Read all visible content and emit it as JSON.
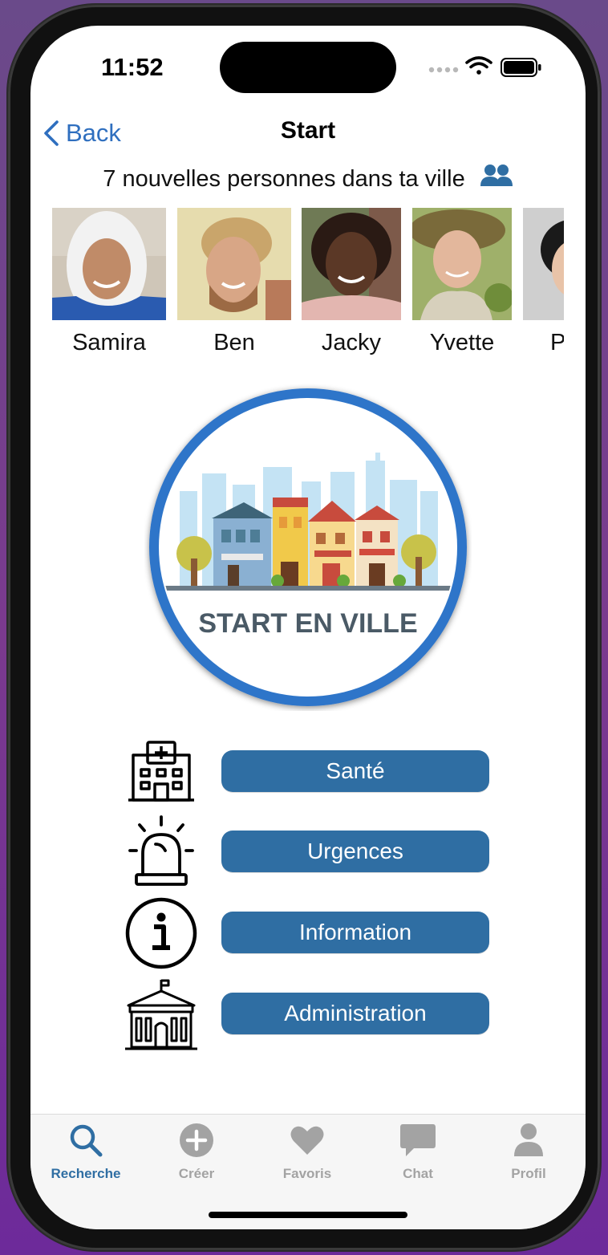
{
  "status": {
    "time": "11:52"
  },
  "nav": {
    "back_label": "Back",
    "title": "Start"
  },
  "headline": "7 nouvelles personnes dans ta ville",
  "people": [
    {
      "name": "Samira"
    },
    {
      "name": "Ben"
    },
    {
      "name": "Jacky"
    },
    {
      "name": "Yvette"
    },
    {
      "name": "P"
    }
  ],
  "logo": {
    "text": "START EN VILLE"
  },
  "actions": [
    {
      "label": "Santé",
      "icon": "hospital-icon"
    },
    {
      "label": "Urgences",
      "icon": "siren-icon"
    },
    {
      "label": "Information",
      "icon": "info-icon"
    },
    {
      "label": "Administration",
      "icon": "city-hall-icon"
    }
  ],
  "tabbar": {
    "items": [
      {
        "label": "Recherche",
        "icon": "search-icon",
        "active": true
      },
      {
        "label": "Créer",
        "icon": "plus-circle-icon",
        "active": false
      },
      {
        "label": "Favoris",
        "icon": "heart-icon",
        "active": false
      },
      {
        "label": "Chat",
        "icon": "chat-icon",
        "active": false
      },
      {
        "label": "Profil",
        "icon": "profile-icon",
        "active": false
      }
    ]
  },
  "colors": {
    "accent": "#2f6ea3",
    "link": "#2f6fbf",
    "tab_inactive": "#a3a3a3"
  }
}
